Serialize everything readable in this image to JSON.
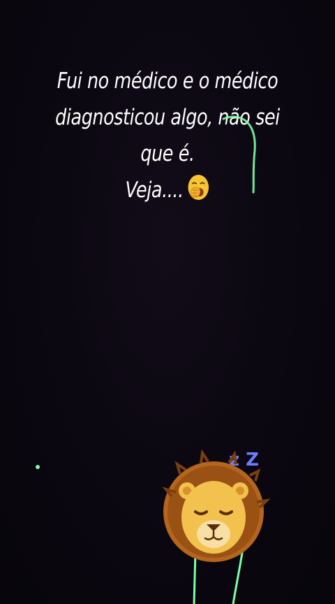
{
  "caption": {
    "line1": "Fui no médico e o médico",
    "line2": "diagnosticou algo, não sei",
    "line3": "que é.",
    "line4": "Veja...."
  },
  "sticker": {
    "zzz": "z Z"
  },
  "icons": {
    "yawn": "yawning-face-icon",
    "lion": "sleeping-lion-sticker"
  },
  "colors": {
    "background": "#0b070f",
    "text": "#ffffff",
    "neon_line": "#7dffa8",
    "zzz": "#6b7cff"
  }
}
